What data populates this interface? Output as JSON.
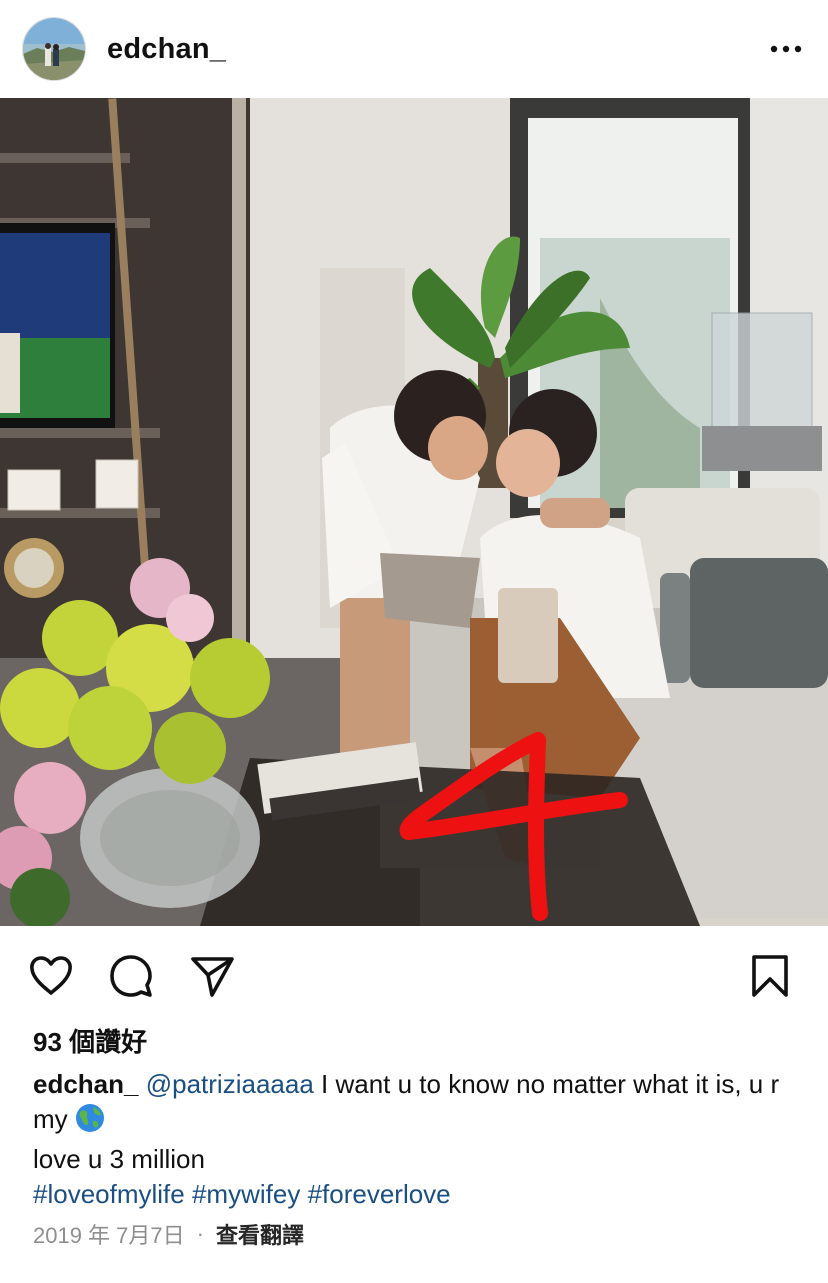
{
  "header": {
    "username": "edchan_",
    "avatar_icon": "profile-photo",
    "more_icon": "ellipsis-icon"
  },
  "photo": {
    "annotation_text": "4",
    "annotation_color": "#ee1111"
  },
  "actions": {
    "like_icon": "heart-icon",
    "comment_icon": "comment-icon",
    "share_icon": "paper-plane-icon",
    "save_icon": "bookmark-icon"
  },
  "likes": {
    "text": "93 個讚好"
  },
  "caption": {
    "username": "edchan_",
    "mention": "@patriziaaaaa",
    "text_line1": " I want u to know no matter what it is, u r my ",
    "emoji_icon": "globe-emoji",
    "text_line2": "love u 3 million",
    "hashtags": [
      "#loveofmylife",
      "#mywifey",
      "#foreverlove"
    ]
  },
  "meta": {
    "date": "2019 年 7月7日",
    "separator": "·",
    "translate_label": "查看翻譯"
  },
  "colors": {
    "link": "#1b4f83",
    "muted": "#8e8e8e",
    "text": "#111111"
  }
}
